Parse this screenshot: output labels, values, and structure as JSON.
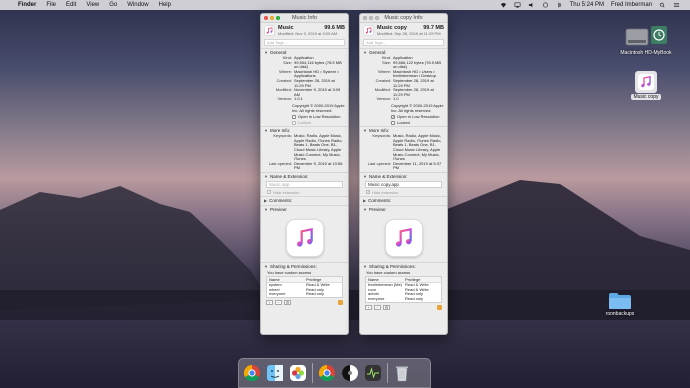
{
  "menubar": {
    "app_name": "Finder",
    "menus": [
      "File",
      "Edit",
      "View",
      "Go",
      "Window",
      "Help"
    ],
    "clock": "Thu 5:24 PM",
    "user": "Fred Imberman"
  },
  "desktop": {
    "icons": [
      {
        "label": "Macintosh HD-MyBook",
        "icon": "hard-drive-icon"
      },
      {
        "label": "Music copy",
        "icon": "music-app-icon",
        "selected": true
      },
      {
        "label": "roonbackups",
        "icon": "folder-icon"
      }
    ]
  },
  "window1": {
    "title": "Music Info",
    "name": "Music",
    "size": "99.6 MB",
    "modified": "Modified: Nov 9, 2019 at 3:09 AM",
    "tags_placeholder": "Add Tags...",
    "general_label": "General:",
    "general": [
      {
        "k": "Kind:",
        "v": "Application"
      },
      {
        "k": "Size:",
        "v": "99,554,116 bytes (78.5 MB on disk)"
      },
      {
        "k": "Where:",
        "v": "Macintosh HD • System • Applications"
      },
      {
        "k": "Created:",
        "v": "September 28, 2019 at 11:29 PM"
      },
      {
        "k": "Modified:",
        "v": "November 9, 2019 at 3:09 AM"
      },
      {
        "k": "Version:",
        "v": "1.0.1"
      }
    ],
    "copyright": "Copyright © 2000-2019 Apple Inc. All rights reserved.",
    "open_low_res": "Open in Low Resolution",
    "locked": "Locked",
    "more_info_label": "More Info:",
    "more_info": [
      {
        "k": "Keywords:",
        "v": "Music, Radio, Apple Music, Apple Radio, iTunes Radio, Beats 1, Beats One, B1, Cloud Music Library, Apple Music Connect, My Music, iTunes"
      },
      {
        "k": "Last opened:",
        "v": "December 9, 2019 at 10:56 PM"
      }
    ],
    "name_ext_label": "Name & Extension:",
    "name_value": "Music.app",
    "hide_extension": "Hide extension",
    "comments_label": "Comments:",
    "preview_label": "Preview:",
    "sharing_label": "Sharing & Permissions:",
    "access_note": "You have custom access",
    "perm_headers": {
      "name": "Name",
      "priv": "Privilege"
    },
    "perms": [
      {
        "n": "system",
        "p": "Read & Write"
      },
      {
        "n": "wheel",
        "p": "Read only"
      },
      {
        "n": "everyone",
        "p": "Read only"
      }
    ]
  },
  "window2": {
    "title": "Music copy Info",
    "name": "Music copy",
    "size": "99.7 MB",
    "modified": "Modified: Sep 28, 2019 at 11:29 PM",
    "tags_placeholder": "Add Tags...",
    "general_label": "General:",
    "general": [
      {
        "k": "Kind:",
        "v": "Application"
      },
      {
        "k": "Size:",
        "v": "99,666,122 bytes (78.5 MB on disk)"
      },
      {
        "k": "Where:",
        "v": "Macintosh HD • Users • fredimberman • Desktop"
      },
      {
        "k": "Created:",
        "v": "September 28, 2019 at 11:29 PM"
      },
      {
        "k": "Modified:",
        "v": "September 28, 2019 at 11:29 PM"
      },
      {
        "k": "Version:",
        "v": "1.0"
      }
    ],
    "copyright": "Copyright © 2000-2019 Apple Inc. All rights reserved.",
    "open_low_res": "Open in Low Resolution",
    "locked": "Locked",
    "more_info_label": "More Info:",
    "more_info": [
      {
        "k": "Keywords:",
        "v": "Music, Radio, Apple Music, Apple Radio, iTunes Radio, Beats 1, Beats One, B1, Cloud Music Library, Apple Music Connect, My Music, iTunes"
      },
      {
        "k": "Last opened:",
        "v": "December 11, 2019 at 5:37 PM"
      }
    ],
    "name_ext_label": "Name & Extension:",
    "name_value": "Music copy.app",
    "hide_extension": "Hide extension",
    "comments_label": "Comments:",
    "preview_label": "Preview:",
    "sharing_label": "Sharing & Permissions:",
    "access_note": "You have custom access",
    "perm_headers": {
      "name": "Name",
      "priv": "Privilege"
    },
    "perms": [
      {
        "n": "fredimberman (Me)",
        "p": "Read & Write"
      },
      {
        "n": "roon",
        "p": "Read & Write"
      },
      {
        "n": "admin",
        "p": "Read only"
      },
      {
        "n": "everyone",
        "p": "Read only"
      }
    ]
  },
  "dock": {
    "items": [
      "chrome-icon",
      "finder-icon",
      "photos-icon",
      "chrome-icon",
      "roon-icon",
      "activity-monitor-icon",
      "trash-icon"
    ]
  }
}
